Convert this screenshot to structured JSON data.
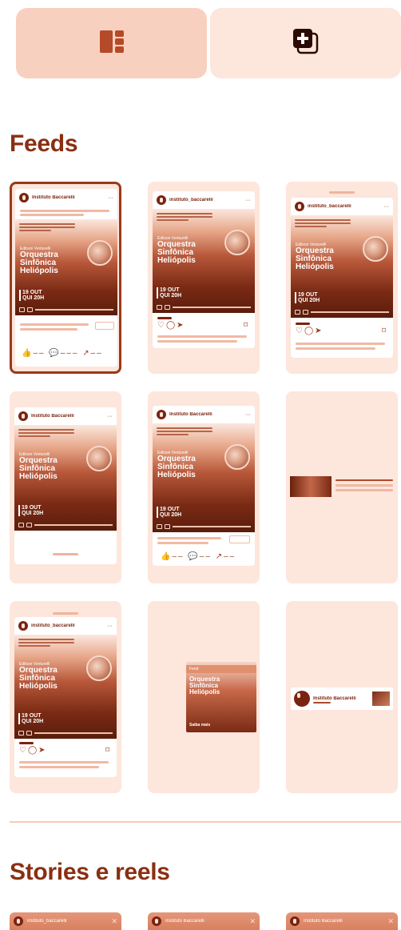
{
  "toggle": {
    "left_icon": "layout-grid-icon",
    "right_icon": "add-media-icon",
    "active": "left"
  },
  "sections": {
    "feeds_title": "Feeds",
    "stories_title": "Stories e reels"
  },
  "account": {
    "name_display": "Instituto Baccarelli",
    "handle": "instituto_baccarelli"
  },
  "post_art": {
    "pre_title": "Edilson Venturelli",
    "title": "Orquestra\nSinfônica\nHeliópolis",
    "date": "19 OUT\nQUI 20H",
    "more_label": "Saiba mais",
    "overlay_text": "Feed"
  },
  "feeds": [
    {
      "variant": "facebook",
      "selected": true
    },
    {
      "variant": "instagram",
      "selected": false
    },
    {
      "variant": "instagram",
      "selected": false
    },
    {
      "variant": "facebook-short",
      "selected": false
    },
    {
      "variant": "facebook-framed",
      "selected": false
    },
    {
      "variant": "sidebar-thumb",
      "selected": false
    },
    {
      "variant": "instagram",
      "selected": false
    },
    {
      "variant": "overlay",
      "selected": false
    },
    {
      "variant": "message",
      "selected": false
    }
  ],
  "stories": [
    {
      "close_icon": "close-icon"
    },
    {
      "close_icon": "close-icon"
    },
    {
      "close_icon": "close-icon"
    }
  ],
  "colors": {
    "accent": "#8a2f12",
    "panel": "#fde6dc",
    "active_toggle": "#f8d0bf"
  }
}
